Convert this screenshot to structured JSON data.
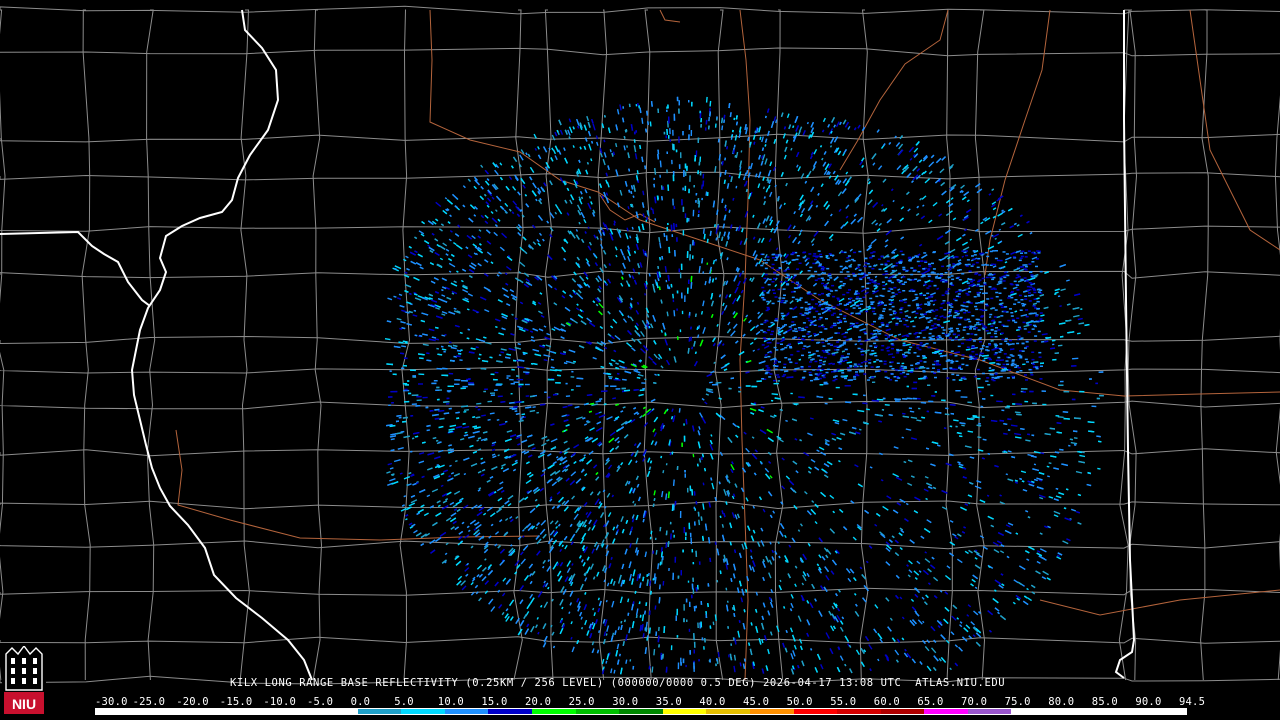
{
  "product": {
    "radar": "KILX",
    "title_line": "KILX LONG RANGE BASE REFLECTIVITY (0.25KM / 256 LEVEL) (000000/0000 0.5 DEG) 2026-04-17 13:08 UTC  ATLAS.NIU.EDU"
  },
  "color_scale": {
    "labels": [
      "-30.0",
      "-25.0",
      "-20.0",
      "-15.0",
      "-10.0",
      "-5.0",
      "0.0",
      "5.0",
      "10.0",
      "15.0",
      "20.0",
      "25.0",
      "30.0",
      "35.0",
      "40.0",
      "45.0",
      "50.0",
      "55.0",
      "60.0",
      "65.0",
      "70.0",
      "75.0",
      "80.0",
      "85.0",
      "90.0",
      "94.5"
    ],
    "colors": [
      "#ffffff",
      "#ffffff",
      "#ffffff",
      "#ffffff",
      "#ffffff",
      "#ffffff",
      "#1fa0c8",
      "#00d8ff",
      "#1e90ff",
      "#0000c8",
      "#00ff00",
      "#00c000",
      "#008800",
      "#ffff00",
      "#e6c000",
      "#ff9000",
      "#ff0000",
      "#d40000",
      "#b00000",
      "#ff00ff",
      "#9955cc",
      "#ffffff",
      "#ffffff",
      "#ffffff",
      "#ffffff"
    ]
  },
  "logo": {
    "text": "NIU",
    "icon": "university-tower-icon"
  },
  "map": {
    "state_border_color": "#ffffff",
    "county_border_color": "#8c8c8c",
    "highway_color": "#b4643c",
    "echo_colors": [
      "#1fa0c8",
      "#00d8ff",
      "#1e90ff",
      "#0000c8",
      "#00ff00"
    ]
  }
}
